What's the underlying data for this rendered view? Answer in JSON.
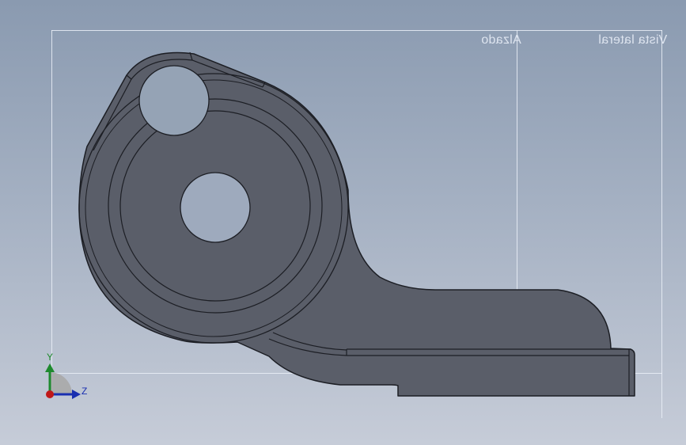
{
  "viewport": {
    "background_top": "#8a9ab0",
    "background_bottom": "#c6ccd8"
  },
  "view_labels": {
    "right_view": "Vista lateral",
    "elevation_view": "Alzado"
  },
  "part": {
    "fill": "#5a5e69",
    "edge": "#1c1e24",
    "hole_fill": "#95a3b5"
  },
  "triad": {
    "y_label": "Y",
    "z_label": "Z",
    "y_color": "#1f8a2e",
    "z_color": "#1a2fb0",
    "x_color": "#c01818"
  }
}
